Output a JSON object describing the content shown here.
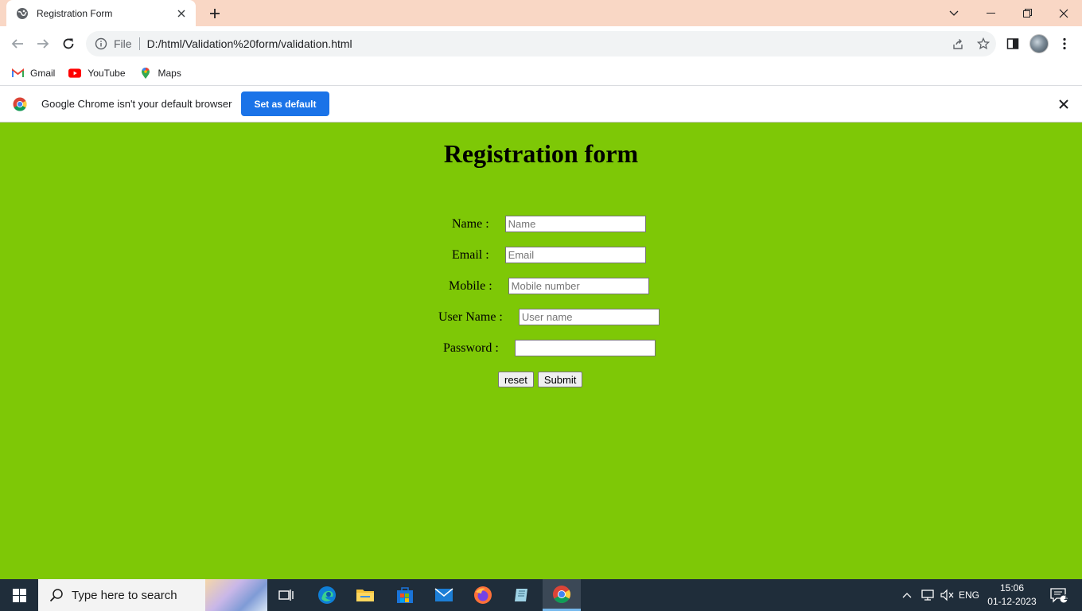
{
  "browser": {
    "tab": {
      "title": "Registration Form"
    },
    "omnibox": {
      "scheme_label": "File",
      "url": "D:/html/Validation%20form/validation.html"
    },
    "bookmarks": [
      {
        "label": "Gmail",
        "icon": "gmail-icon"
      },
      {
        "label": "YouTube",
        "icon": "youtube-icon"
      },
      {
        "label": "Maps",
        "icon": "maps-icon"
      }
    ],
    "infobar": {
      "message": "Google Chrome isn't your default browser",
      "button_label": "Set as default"
    }
  },
  "page": {
    "heading": "Registration form",
    "fields": [
      {
        "label": "Name :",
        "placeholder": "Name",
        "value": ""
      },
      {
        "label": "Email :",
        "placeholder": "Email",
        "value": ""
      },
      {
        "label": "Mobile :",
        "placeholder": "Mobile number",
        "value": ""
      },
      {
        "label": "User Name :",
        "placeholder": "User name",
        "value": ""
      },
      {
        "label": "Password :",
        "placeholder": "",
        "value": ""
      }
    ],
    "buttons": {
      "reset": "reset",
      "submit": "Submit"
    },
    "background_color": "#7ec806"
  },
  "taskbar": {
    "search_placeholder": "Type here to search",
    "language": "ENG",
    "time": "15:06",
    "date": "01-12-2023",
    "notification_count": "1"
  }
}
